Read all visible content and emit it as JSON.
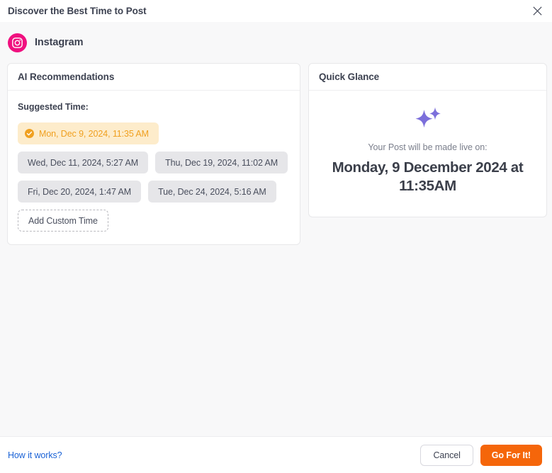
{
  "header": {
    "title": "Discover the Best Time to Post",
    "close_icon": "close-icon"
  },
  "platform": {
    "name": "Instagram",
    "icon": "instagram-icon",
    "brand_color": "#f0107f"
  },
  "ai_panel": {
    "title": "AI Recommendations",
    "suggested_label": "Suggested Time:",
    "selected_color": "#f0a020",
    "selected_bg": "#fdeccb",
    "chip_bg": "#e6e6e9",
    "times": [
      {
        "label": "Mon, Dec 9, 2024, 11:35 AM",
        "selected": true
      },
      {
        "label": "Wed, Dec 11, 2024, 5:27 AM",
        "selected": false
      },
      {
        "label": "Thu, Dec 19, 2024, 11:02 AM",
        "selected": false
      },
      {
        "label": "Fri, Dec 20, 2024, 1:47 AM",
        "selected": false
      },
      {
        "label": "Tue, Dec 24, 2024, 5:16 AM",
        "selected": false
      }
    ],
    "add_custom_label": "Add Custom Time"
  },
  "quick_glance": {
    "title": "Quick Glance",
    "sparkle_icon": "sparkles-icon",
    "sparkle_color": "#7c6fdb",
    "live_on_label": "Your Post will be made live on:",
    "live_on_date": "Monday, 9 December 2024 at 11:35AM"
  },
  "footer": {
    "how_it_works_label": "How it works?",
    "cancel_label": "Cancel",
    "primary_label": "Go For It!",
    "primary_color": "#f5660a",
    "link_color": "#1a62d6"
  }
}
